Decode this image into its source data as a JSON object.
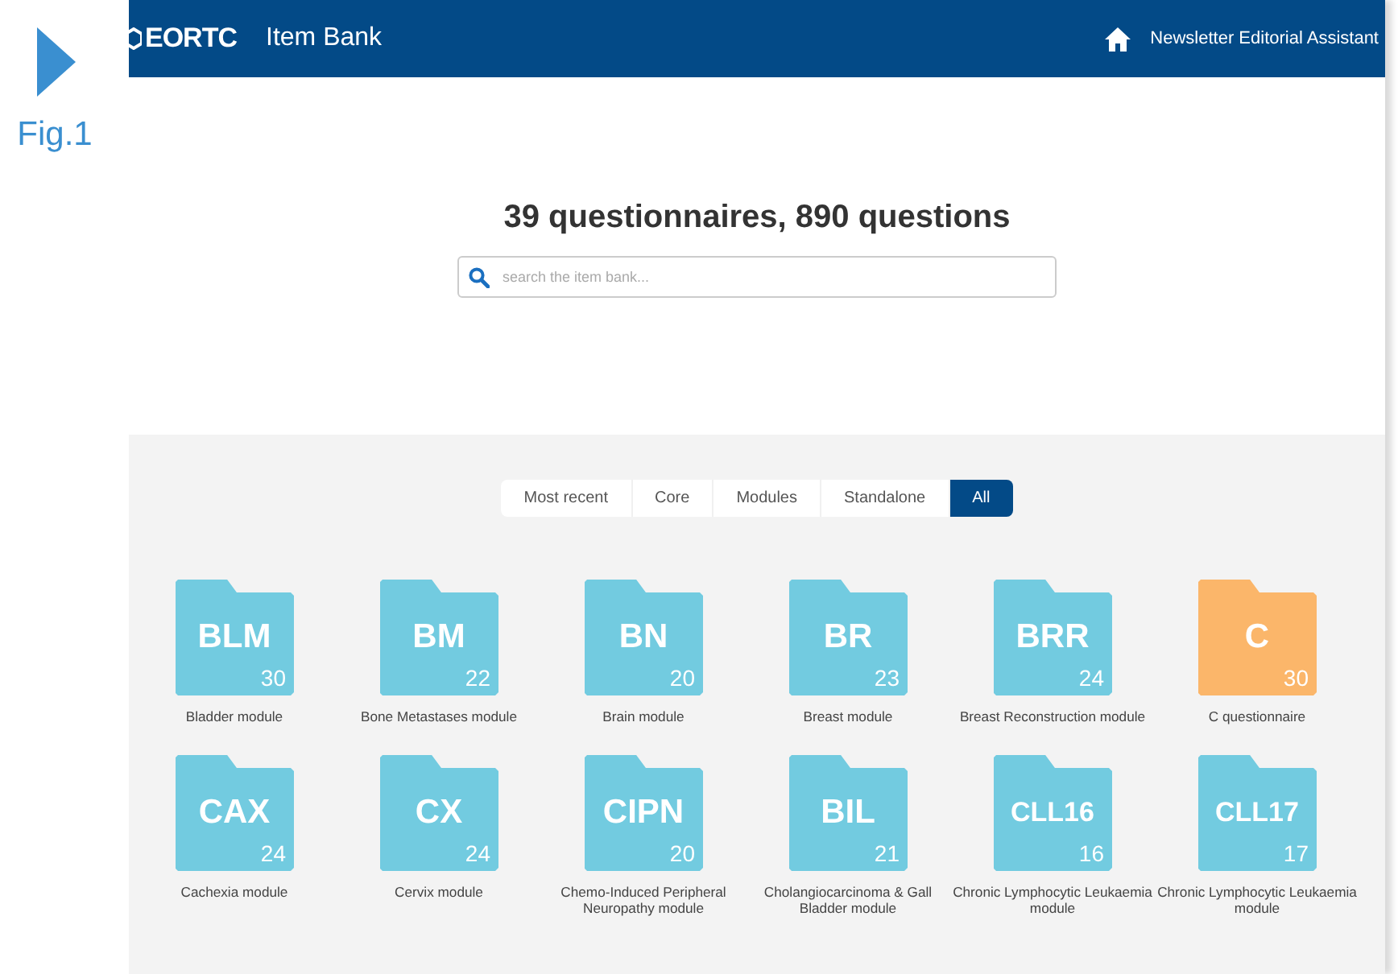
{
  "figure": {
    "caption": "Fig.1"
  },
  "header": {
    "brand": "EORTC",
    "title": "Item Bank",
    "user": "Newsletter Editorial Assistant"
  },
  "heading": "39 questionnaires, 890 questions",
  "search": {
    "placeholder": "search the item bank..."
  },
  "filters": [
    {
      "label": "Most recent",
      "selected": false
    },
    {
      "label": "Core",
      "selected": false
    },
    {
      "label": "Modules",
      "selected": false
    },
    {
      "label": "Standalone",
      "selected": false
    },
    {
      "label": "All",
      "selected": true
    }
  ],
  "items": [
    {
      "code": "BLM",
      "count": "30",
      "name": "Bladder module",
      "color": "#72cbe0"
    },
    {
      "code": "BM",
      "count": "22",
      "name": "Bone Metastases module",
      "color": "#72cbe0"
    },
    {
      "code": "BN",
      "count": "20",
      "name": "Brain module",
      "color": "#72cbe0"
    },
    {
      "code": "BR",
      "count": "23",
      "name": "Breast module",
      "color": "#72cbe0"
    },
    {
      "code": "BRR",
      "count": "24",
      "name": "Breast Reconstruction module",
      "color": "#72cbe0"
    },
    {
      "code": "C",
      "count": "30",
      "name": "C questionnaire",
      "color": "#fbb66a"
    },
    {
      "code": "CAX",
      "count": "24",
      "name": "Cachexia module",
      "color": "#72cbe0"
    },
    {
      "code": "CX",
      "count": "24",
      "name": "Cervix module",
      "color": "#72cbe0"
    },
    {
      "code": "CIPN",
      "count": "20",
      "name": "Chemo-Induced Peripheral Neuropathy module",
      "color": "#72cbe0"
    },
    {
      "code": "BIL",
      "count": "21",
      "name": "Cholangiocarcinoma & Gall Bladder module",
      "color": "#72cbe0"
    },
    {
      "code": "CLL16",
      "count": "16",
      "name": "Chronic Lymphocytic Leukaemia module",
      "color": "#72cbe0"
    },
    {
      "code": "CLL17",
      "count": "17",
      "name": "Chronic Lymphocytic Leukaemia module",
      "color": "#72cbe0"
    }
  ]
}
